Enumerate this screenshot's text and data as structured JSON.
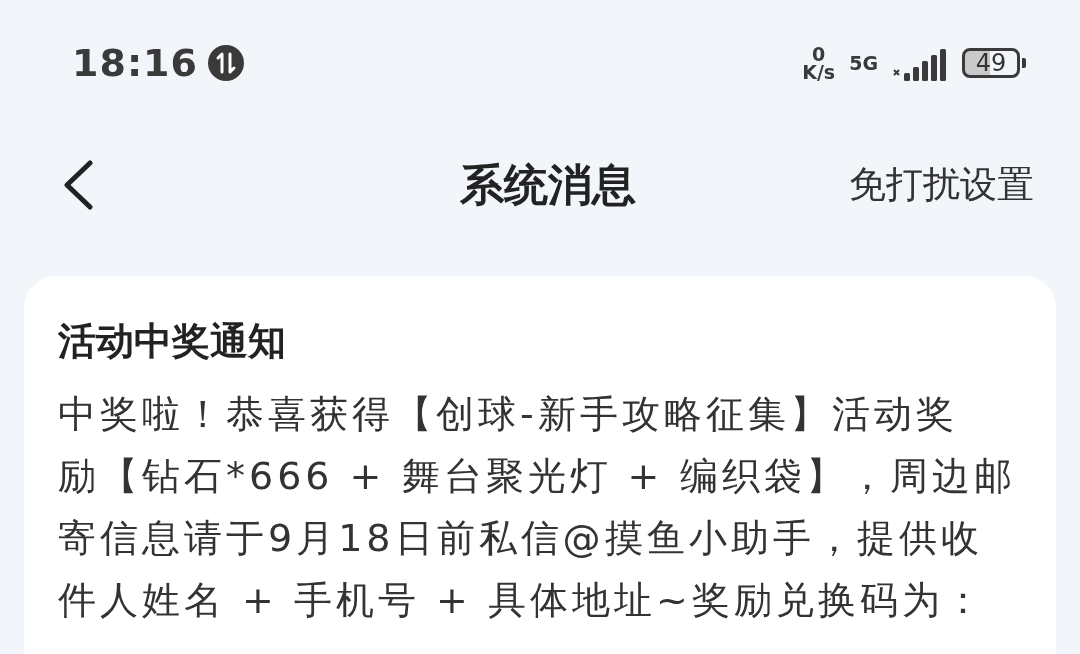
{
  "status_bar": {
    "time": "18:16",
    "net_speed_value": "0",
    "net_speed_unit": "K/s",
    "network": "5G",
    "battery": "49"
  },
  "header": {
    "title": "系统消息",
    "action": "免打扰设置"
  },
  "messages": [
    {
      "title": "活动中奖通知",
      "lines": [
        "中奖啦！恭喜获得【创球-新手攻略征集】活动奖",
        "励【钻石*666 + 舞台聚光灯 + 编织袋】，周边邮",
        "寄信息请于9月18日前私信@摸鱼小助手，提供收",
        "件人姓名 + 手机号 + 具体地址~奖励兑换码为："
      ]
    }
  ]
}
